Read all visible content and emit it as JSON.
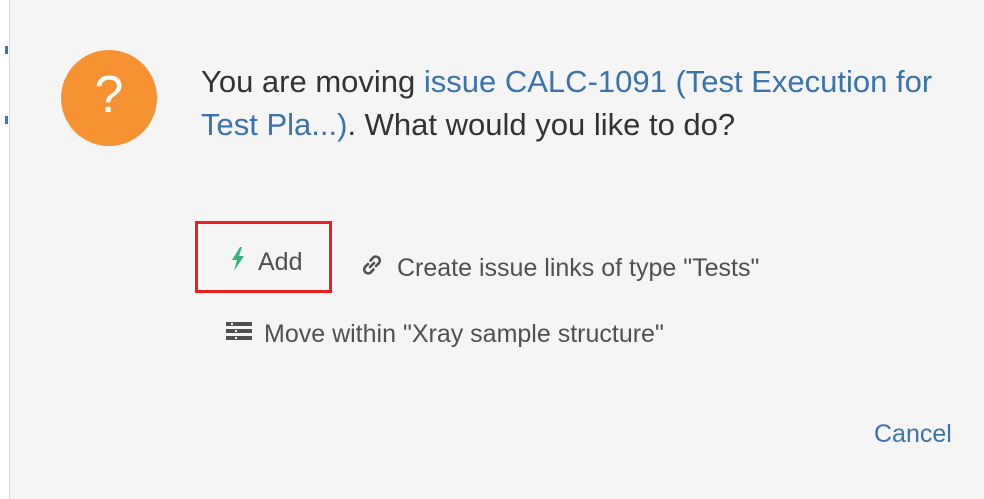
{
  "dialog": {
    "message_prefix": "You are moving ",
    "issue_link": "issue CALC-1091 (Test Execution for Test Pla...)",
    "message_suffix": ". What would you like to do?",
    "icon_symbol": "?",
    "icon_color": "#f79232",
    "accent_color": "#3b73af",
    "highlight_color": "#e8201f"
  },
  "actions": {
    "add_label": "Add",
    "links_label": "Create issue links of type \"Tests\"",
    "move_label": "Move within \"Xray sample structure\""
  },
  "footer": {
    "cancel_label": "Cancel"
  },
  "icons": {
    "question": "question-icon",
    "add": "lightning-bolt-icon",
    "links": "link-chain-icon",
    "move": "structure-list-icon"
  }
}
